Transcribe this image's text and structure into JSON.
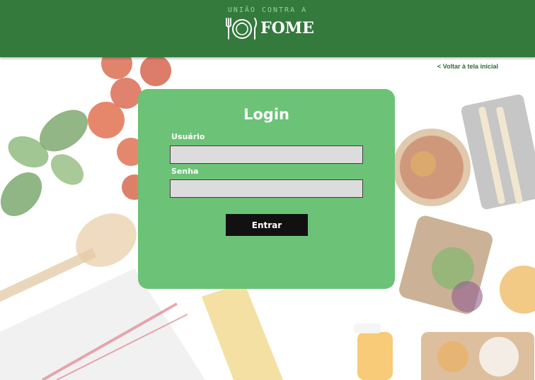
{
  "header": {
    "logo_top_text": "UNIÃO CONTRA A",
    "logo_main_text": "FOME",
    "logo_icon": "plate-fork-knife-icon",
    "background_color": "#347a3c"
  },
  "nav": {
    "back_link": "< Voltar à tela inicial"
  },
  "login": {
    "title": "Login",
    "username_label": "Usuário",
    "username_value": "",
    "password_label": "Senha",
    "password_value": "",
    "submit_label": "Entrar",
    "card_color": "#6cc276"
  }
}
